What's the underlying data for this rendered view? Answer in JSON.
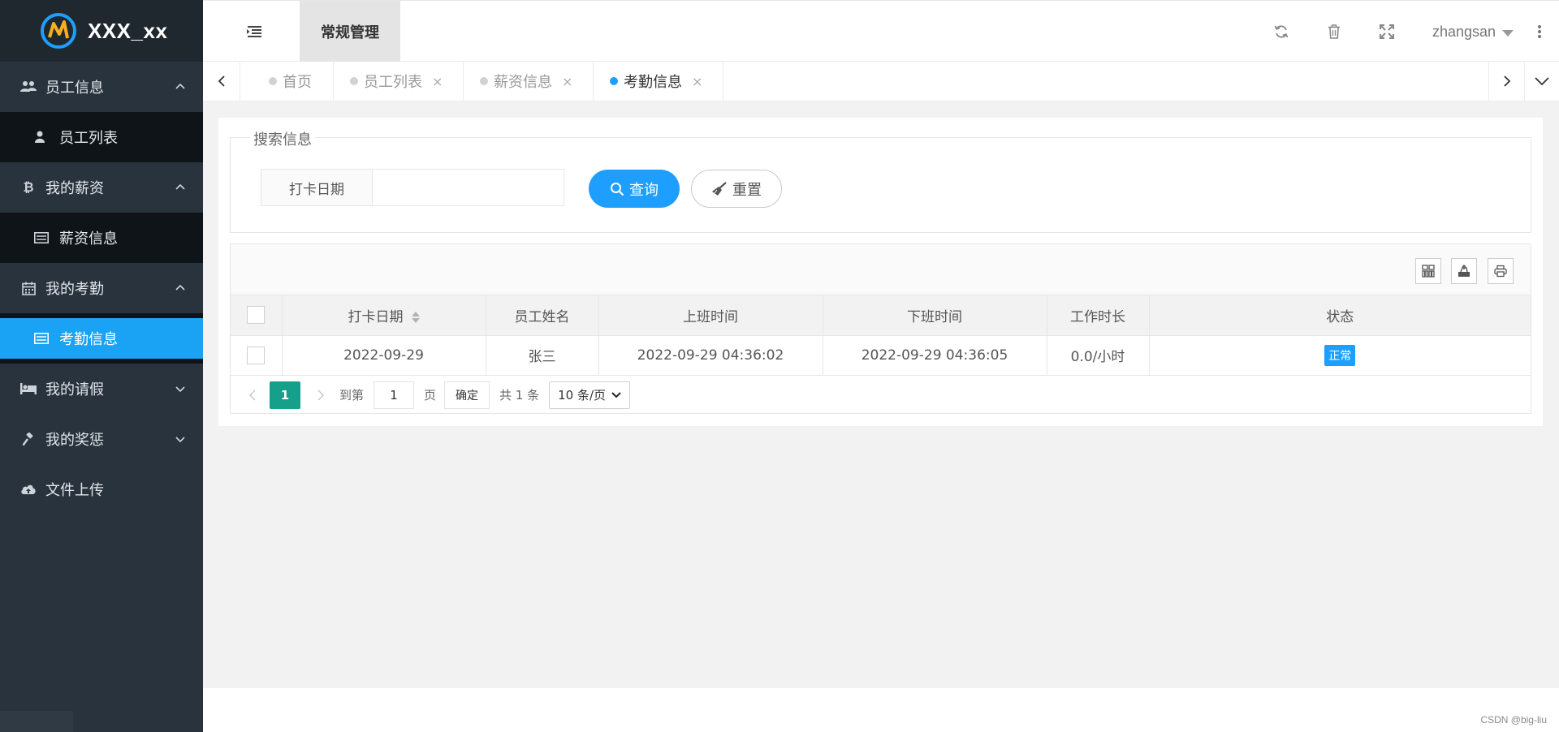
{
  "app": {
    "title": "XXX_xx"
  },
  "sidebar": {
    "groups": [
      {
        "label": "员工信息",
        "icon": "users-icon",
        "expanded": true,
        "items": [
          {
            "label": "员工列表",
            "icon": "user-icon"
          }
        ]
      },
      {
        "label": "我的薪资",
        "icon": "bitcoin-icon",
        "expanded": true,
        "items": [
          {
            "label": "薪资信息",
            "icon": "list-icon"
          }
        ]
      },
      {
        "label": "我的考勤",
        "icon": "calendar-icon",
        "expanded": true,
        "items": [
          {
            "label": "考勤信息",
            "icon": "list-icon",
            "active": true
          }
        ]
      },
      {
        "label": "我的请假",
        "icon": "bed-icon",
        "expanded": false
      },
      {
        "label": "我的奖惩",
        "icon": "gavel-icon",
        "expanded": false
      },
      {
        "label": "文件上传",
        "icon": "cloud-upload-icon"
      }
    ]
  },
  "header": {
    "active_tab": "常规管理",
    "user": "zhangsan"
  },
  "tabs": [
    {
      "label": "首页",
      "closable": false
    },
    {
      "label": "员工列表",
      "closable": true
    },
    {
      "label": "薪资信息",
      "closable": true
    },
    {
      "label": "考勤信息",
      "closable": true,
      "active": true
    }
  ],
  "search": {
    "legend": "搜索信息",
    "field_label": "打卡日期",
    "field_value": "",
    "query_label": "查询",
    "reset_label": "重置"
  },
  "table": {
    "columns": [
      "打卡日期",
      "员工姓名",
      "上班时间",
      "下班时间",
      "工作时长",
      "状态"
    ],
    "rows": [
      {
        "date": "2022-09-29",
        "name": "张三",
        "start": "2022-09-29 04:36:02",
        "end": "2022-09-29 04:36:05",
        "duration": "0.0/小时",
        "status": "正常"
      }
    ]
  },
  "pager": {
    "current": "1",
    "goto_label": "到第",
    "goto_value": "1",
    "page_label": "页",
    "confirm_label": "确定",
    "total_label": "共 1 条",
    "page_size": "10 条/页"
  },
  "colors": {
    "primary": "#1e9fff",
    "sidebar": "#28333e",
    "pager_active": "#16a08c"
  },
  "watermark": "CSDN @big-liu"
}
